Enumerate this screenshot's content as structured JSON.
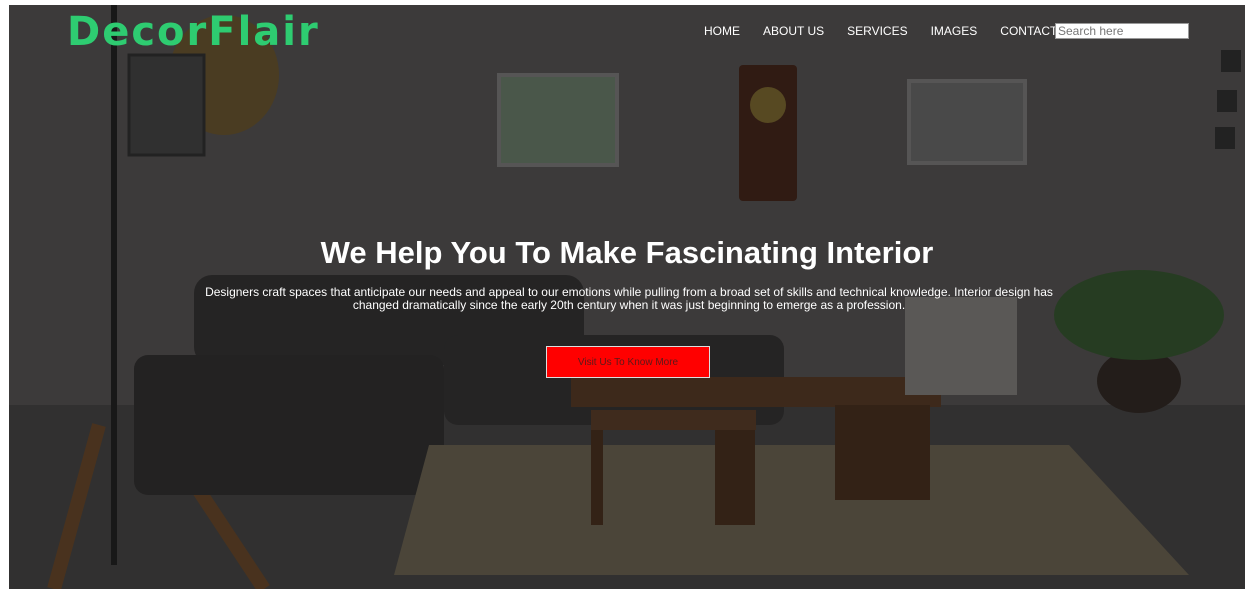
{
  "brand": {
    "logo": "DecorFlair",
    "accent": "#2ecc71"
  },
  "nav": {
    "items": [
      "HOME",
      "ABOUT US",
      "SERVICES",
      "IMAGES",
      "CONTACT US"
    ]
  },
  "search": {
    "placeholder": "Search here"
  },
  "hero": {
    "headline": "We Help You To Make Fascinating Interior",
    "description": "Designers craft spaces that anticipate our needs and appeal to our emotions while pulling from a broad set of skills and technical knowledge. Interior design has changed dramatically since the early 20th century when it was just beginning to emerge as a profession.",
    "cta_label": "Visit Us To Know More",
    "cta_color": "#ff0000"
  }
}
